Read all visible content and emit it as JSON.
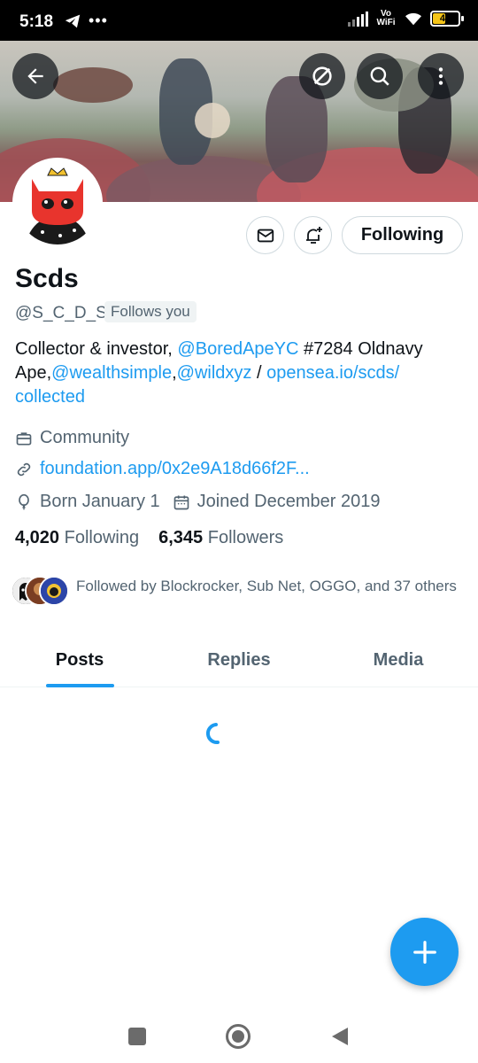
{
  "status_bar": {
    "time": "5:18",
    "left_icons": [
      "telegram-icon",
      "more-dots-icon"
    ],
    "network_label": "Vo WiFi",
    "battery_level": "47"
  },
  "header": {
    "back_icon": "arrow-left-icon",
    "grok_icon": "slash-circle-icon",
    "search_icon": "search-icon",
    "more_icon": "more-vertical-icon"
  },
  "profile": {
    "name": "Scds",
    "handle": "@S_C_D_S_",
    "follows_you": "Follows you",
    "following_button": "Following",
    "bio": {
      "part1": "Collector & investor, ",
      "mention1": "@BoredApeYC",
      "part2": " #7284 Oldnavy Ape,",
      "mention2": "@wealthsimple",
      "part3": ",",
      "mention3": "@wildxyz",
      "part4": " / ",
      "link": "opensea.io/scds/ collected"
    },
    "category": "Community",
    "website": "foundation.app/0x2e9A18d66f2F...",
    "birthday": "Born January 1",
    "joined": "Joined December 2019",
    "following_count": "4,020",
    "following_label": "Following",
    "followers_count": "6,345",
    "followers_label": "Followers",
    "followed_by": "Followed by Blockrocker, Sub Net, OGGO, and 37 others"
  },
  "tabs": [
    {
      "label": "Posts",
      "active": true
    },
    {
      "label": "Replies",
      "active": false
    },
    {
      "label": "Media",
      "active": false
    }
  ],
  "colors": {
    "accent": "#1d9bf0",
    "text_primary": "#0f1419",
    "text_secondary": "#536471"
  }
}
